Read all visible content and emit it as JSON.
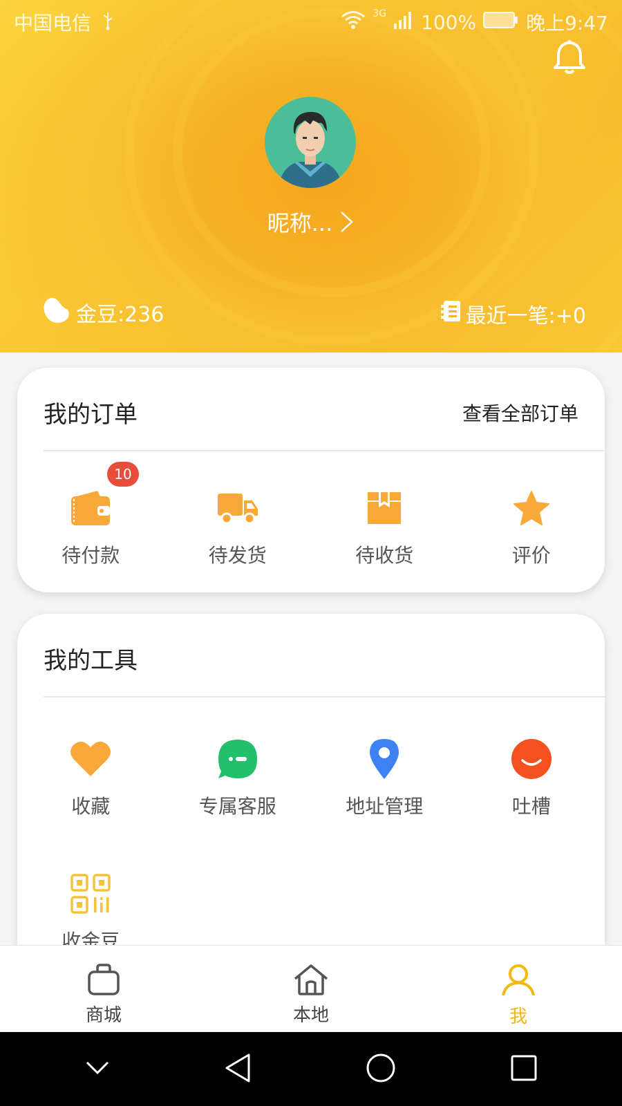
{
  "status_bar": {
    "carrier": "中国电信",
    "network": "3G",
    "battery": "100%",
    "time": "晚上9:47"
  },
  "profile": {
    "nickname": "昵称...",
    "coins_label": "金豆:236",
    "recent_label": "最近一笔:+0"
  },
  "orders": {
    "title": "我的订单",
    "view_all": "查看全部订单",
    "items": [
      {
        "label": "待付款",
        "icon": "wallet-icon",
        "badge": "10"
      },
      {
        "label": "待发货",
        "icon": "truck-icon"
      },
      {
        "label": "待收货",
        "icon": "package-icon"
      },
      {
        "label": "评价",
        "icon": "star-icon"
      }
    ]
  },
  "tools": {
    "title": "我的工具",
    "items": [
      {
        "label": "收藏",
        "icon": "heart-icon"
      },
      {
        "label": "专属客服",
        "icon": "chat-icon"
      },
      {
        "label": "地址管理",
        "icon": "location-pin-icon"
      },
      {
        "label": "吐槽",
        "icon": "smile-icon"
      },
      {
        "label": "收金豆",
        "icon": "qr-code-icon"
      }
    ]
  },
  "bottom_nav": {
    "items": [
      {
        "label": "商城",
        "icon": "shopping-bag-icon"
      },
      {
        "label": "本地",
        "icon": "home-icon"
      },
      {
        "label": "我",
        "icon": "person-icon"
      }
    ]
  },
  "colors": {
    "accent": "#f0b90b",
    "icon_orange": "#f9a83a",
    "chat_green": "#22c06d",
    "pin_blue": "#3d82f2",
    "smile_red": "#f4511e",
    "badge_red": "#e84c3d"
  }
}
